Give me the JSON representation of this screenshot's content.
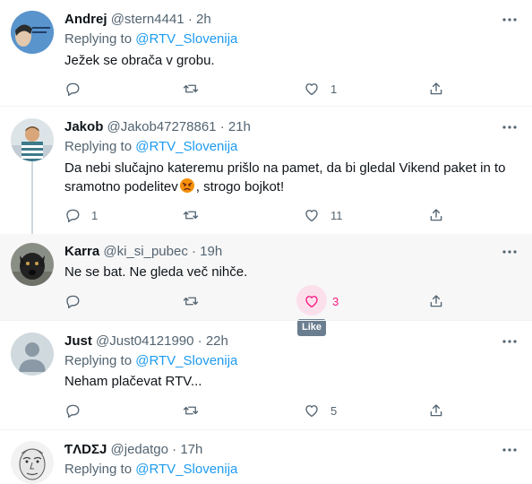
{
  "reply_prefix": "Replying to",
  "tooltip": "Like",
  "colors": {
    "accent": "#1d9bf0",
    "like": "#f91880",
    "muted": "#536471",
    "text": "#0f1419"
  },
  "tweets": [
    {
      "name": "Andrej",
      "handle": "@stern4441",
      "time": "2h",
      "mention": "@RTV_Slovenija",
      "text": "Ježek se obrača v grobu.",
      "reply_count": "",
      "retweet_count": "",
      "like_count": "1"
    },
    {
      "name": "Jakob",
      "handle": "@Jakob47278861",
      "time": "21h",
      "mention": "@RTV_Slovenija",
      "text_line1": "Da nebi slučajno kateremu prišlo na pamet, da bi gledal Vikend paket in to",
      "text_line2_a": "sramotno podelitev",
      "emoji": "angry-face",
      "text_line2_b": ", strogo bojkot!",
      "reply_count": "1",
      "retweet_count": "",
      "like_count": "11"
    },
    {
      "name": "Karra",
      "handle": "@ki_si_pubec",
      "time": "19h",
      "text": "Ne se bat. Ne gleda več nihče.",
      "reply_count": "",
      "retweet_count": "",
      "like_count": "3"
    },
    {
      "name": "Just",
      "handle": "@Just04121990",
      "time": "22h",
      "mention": "@RTV_Slovenija",
      "text": "Neham plačevat RTV...",
      "reply_count": "",
      "retweet_count": "",
      "like_count": "5"
    },
    {
      "name": "ƬΛDΣJ",
      "handle": "@jedatgo",
      "time": "17h",
      "mention": "@RTV_Slovenija"
    }
  ]
}
